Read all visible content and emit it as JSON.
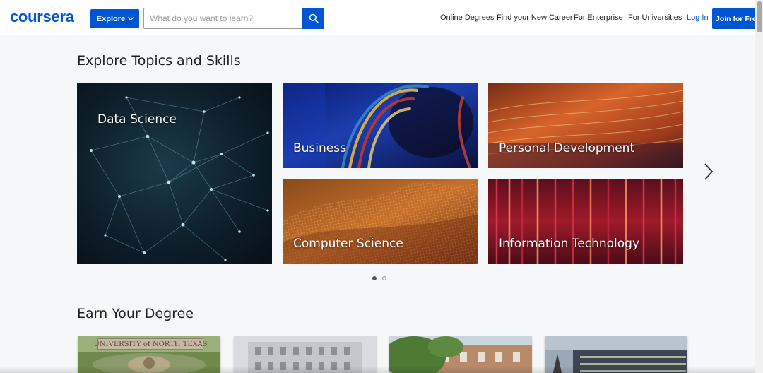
{
  "header": {
    "logo": "coursera",
    "explore_label": "Explore",
    "search_placeholder": "What do you want to learn?",
    "nav_links": [
      "Online Degrees",
      "Find your New Career",
      "For Enterprise",
      "For Universities"
    ],
    "login_label": "Log In",
    "join_label": "Join for Free"
  },
  "topics": {
    "title": "Explore Topics and Skills",
    "tiles": [
      {
        "label": "Data Science"
      },
      {
        "label": "Business"
      },
      {
        "label": "Personal Development"
      },
      {
        "label": "Computer Science"
      },
      {
        "label": "Information Technology"
      }
    ],
    "pages": 2,
    "active_page": 1
  },
  "degrees": {
    "title": "Earn Your Degree",
    "cards": [
      {
        "sign_text": "UNIVERSITY of NORTH TEXAS"
      },
      {
        "sign_text": ""
      },
      {
        "sign_text": ""
      },
      {
        "sign_text": ""
      }
    ]
  },
  "colors": {
    "brand": "#0056d2",
    "background": "#f5f7f8"
  },
  "icons": {
    "search": "search-icon",
    "explore_chevron": "chevron-down-icon",
    "carousel_next": "chevron-right-icon"
  }
}
